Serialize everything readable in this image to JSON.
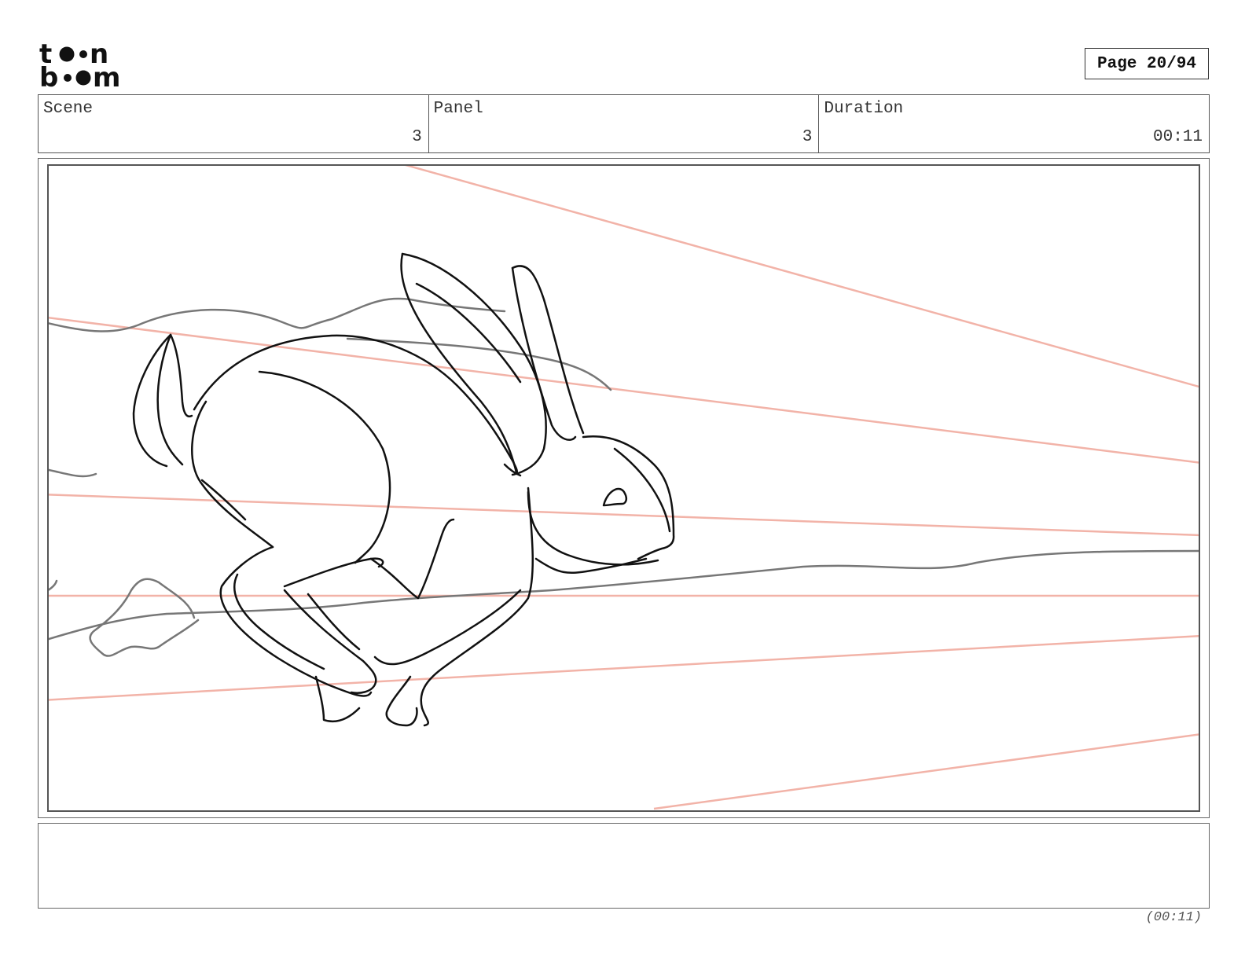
{
  "logo": {
    "line1": "toon",
    "line2": "boom"
  },
  "page": {
    "label": "Page 20/94"
  },
  "info": {
    "scene_label": "Scene",
    "scene_value": "3",
    "panel_label": "Panel",
    "panel_value": "3",
    "duration_label": "Duration",
    "duration_value": "00:11"
  },
  "notes": {
    "text": ""
  },
  "footer": {
    "duration": "(00:11)"
  },
  "colors": {
    "speed_lines": "#f2b3a8",
    "sketch": "#111111",
    "ground": "#777777"
  }
}
